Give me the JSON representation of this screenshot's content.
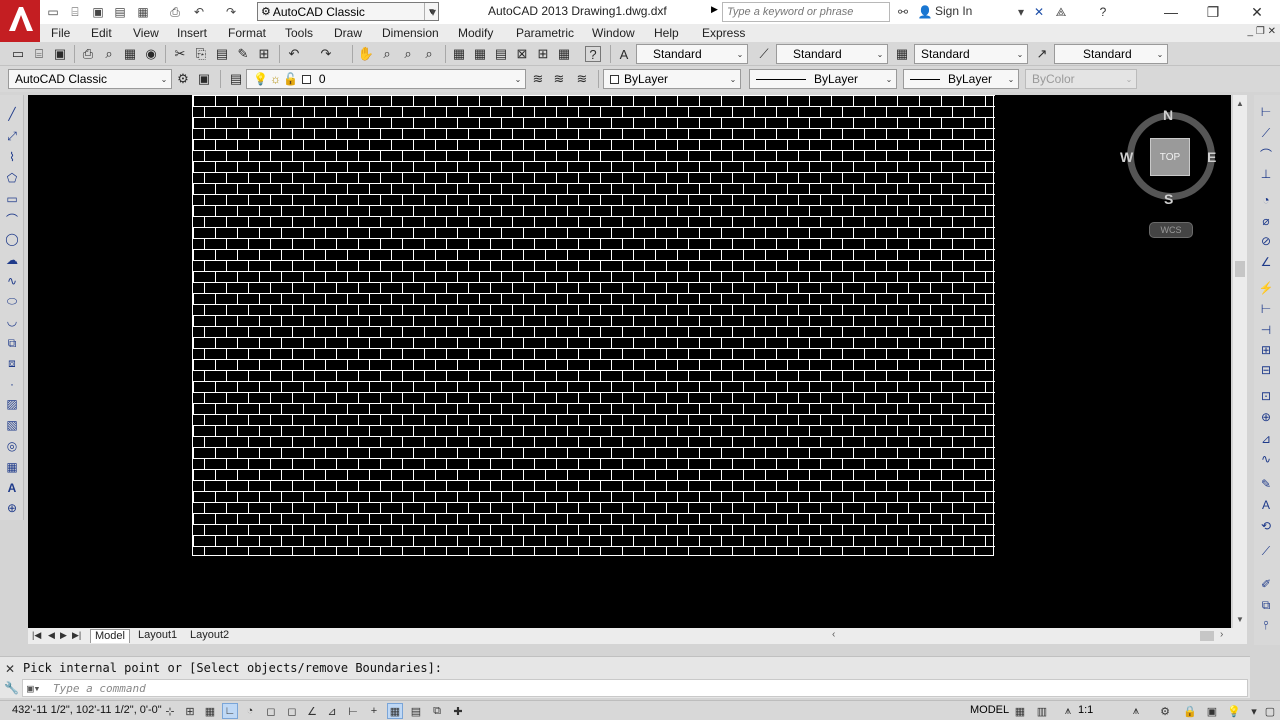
{
  "titlebar": {
    "app_title": "AutoCAD 2013    Drawing1.dwg.dxf",
    "workspace": "AutoCAD Classic",
    "search_placeholder": "Type a keyword or phrase",
    "signin_label": "Sign In"
  },
  "menu": {
    "items": [
      "File",
      "Edit",
      "View",
      "Insert",
      "Format",
      "Tools",
      "Draw",
      "Dimension",
      "Modify",
      "Parametric",
      "Window",
      "Help",
      "Express"
    ]
  },
  "styles_toolbar": {
    "text_style": "Standard",
    "dim_style": "Standard",
    "table_style": "Standard",
    "mleader_style": "Standard"
  },
  "layers_toolbar": {
    "workspace": "AutoCAD Classic",
    "layer": "0",
    "color": "ByLayer",
    "linetype": "ByLayer",
    "lineweight": "ByLayer",
    "plotstyle": "ByColor"
  },
  "viewcube": {
    "top_label": "TOP",
    "north": "N",
    "south": "S",
    "east": "E",
    "west": "W",
    "wcs_label": "WCS"
  },
  "tabs": {
    "model": "Model",
    "layout1": "Layout1",
    "layout2": "Layout2"
  },
  "command": {
    "history": "Pick internal point or [Select objects/remove Boundaries]:",
    "placeholder": "Type a command"
  },
  "status": {
    "coords": "432'-11 1/2\", 102'-11 1/2\", 0'-0\"",
    "model": "MODEL",
    "annotation_scale": "1:1"
  },
  "hatch": {
    "pattern": "brick",
    "line_color": "#ffffff",
    "background": "#000000"
  },
  "colors": {
    "app_red": "#c41e22",
    "canvas": "#000000",
    "chrome": "#d8d8d8"
  }
}
